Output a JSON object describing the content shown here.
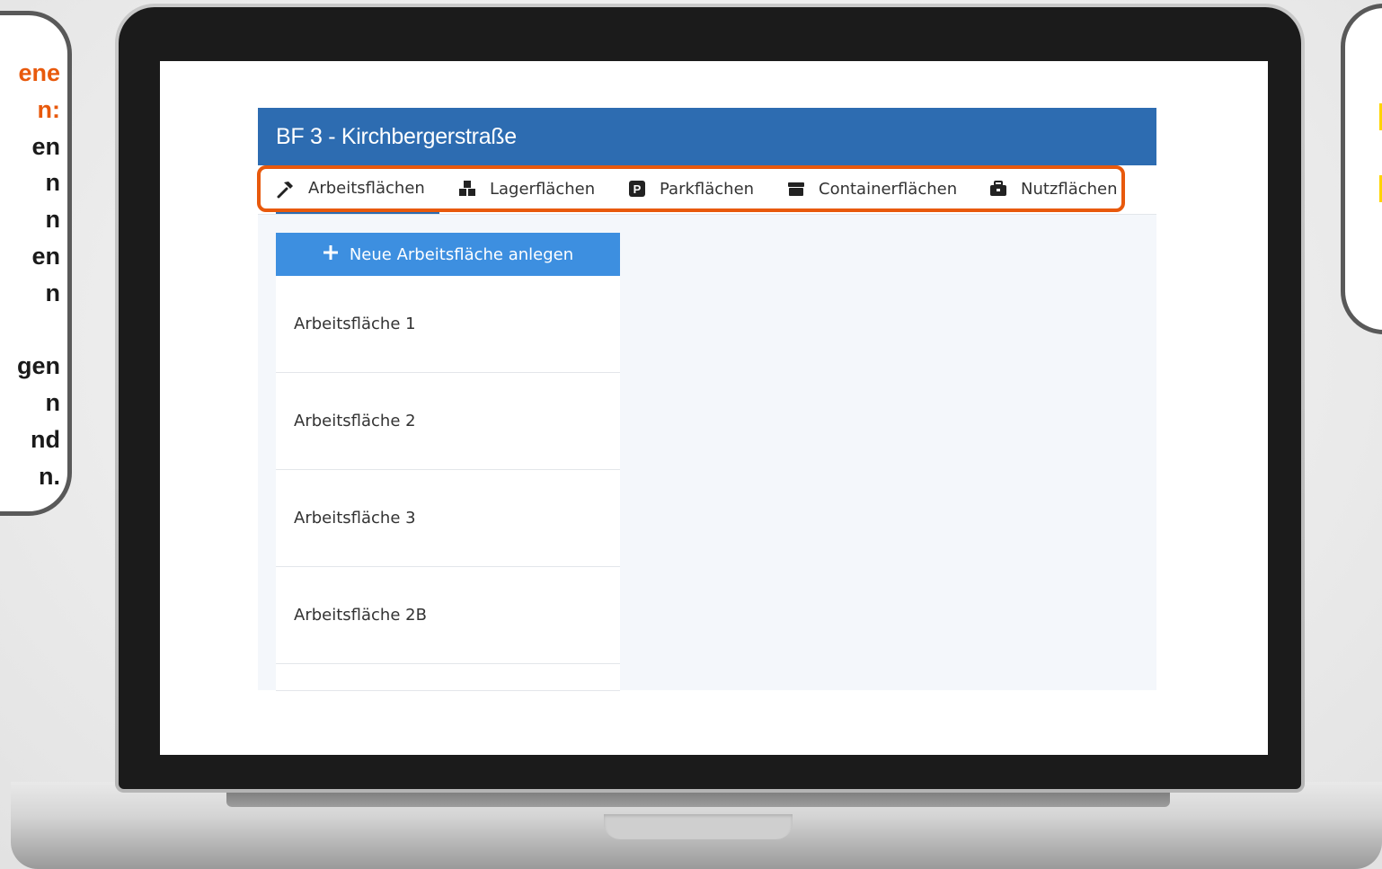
{
  "callout_left": {
    "lines": [
      "ene",
      "n:",
      "en",
      "n",
      "n",
      "en",
      "n",
      "",
      "gen",
      "n",
      "nd",
      "n."
    ]
  },
  "app": {
    "title": "BF 3 - Kirchbergerstraße",
    "tabs": [
      {
        "label": "Arbeitsflächen",
        "icon": "hammer-icon",
        "active": true
      },
      {
        "label": "Lagerflächen",
        "icon": "boxes-icon",
        "active": false
      },
      {
        "label": "Parkflächen",
        "icon": "parking-icon",
        "active": false
      },
      {
        "label": "Containerflächen",
        "icon": "container-icon",
        "active": false
      },
      {
        "label": "Nutzflächen",
        "icon": "toolbox-icon",
        "active": false
      }
    ],
    "new_button_label": "Neue Arbeitsfläche anlegen",
    "list": [
      "Arbeitsfläche 1",
      "Arbeitsfläche 2",
      "Arbeitsfläche 3",
      "Arbeitsfläche 2B"
    ]
  },
  "colors": {
    "header": "#2d6cb1",
    "accent_button": "#3d8fe0",
    "highlight": "#e8590c",
    "callout_accent": "#e8590c",
    "marker": "#ffd400"
  }
}
